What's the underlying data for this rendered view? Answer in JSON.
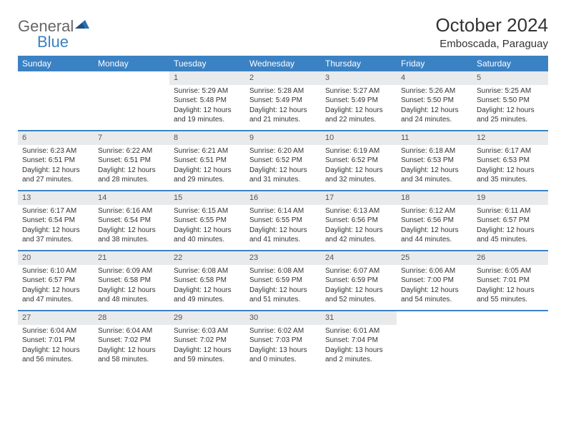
{
  "brand": {
    "part1": "General",
    "part2": "Blue"
  },
  "header": {
    "title": "October 2024",
    "location": "Emboscada, Paraguay"
  },
  "weekdays": [
    "Sunday",
    "Monday",
    "Tuesday",
    "Wednesday",
    "Thursday",
    "Friday",
    "Saturday"
  ],
  "weeks": [
    [
      {
        "empty": true
      },
      {
        "empty": true
      },
      {
        "day": "1",
        "sunrise": "5:29 AM",
        "sunset": "5:48 PM",
        "daylight": "12 hours and 19 minutes."
      },
      {
        "day": "2",
        "sunrise": "5:28 AM",
        "sunset": "5:49 PM",
        "daylight": "12 hours and 21 minutes."
      },
      {
        "day": "3",
        "sunrise": "5:27 AM",
        "sunset": "5:49 PM",
        "daylight": "12 hours and 22 minutes."
      },
      {
        "day": "4",
        "sunrise": "5:26 AM",
        "sunset": "5:50 PM",
        "daylight": "12 hours and 24 minutes."
      },
      {
        "day": "5",
        "sunrise": "5:25 AM",
        "sunset": "5:50 PM",
        "daylight": "12 hours and 25 minutes."
      }
    ],
    [
      {
        "day": "6",
        "sunrise": "6:23 AM",
        "sunset": "6:51 PM",
        "daylight": "12 hours and 27 minutes."
      },
      {
        "day": "7",
        "sunrise": "6:22 AM",
        "sunset": "6:51 PM",
        "daylight": "12 hours and 28 minutes."
      },
      {
        "day": "8",
        "sunrise": "6:21 AM",
        "sunset": "6:51 PM",
        "daylight": "12 hours and 29 minutes."
      },
      {
        "day": "9",
        "sunrise": "6:20 AM",
        "sunset": "6:52 PM",
        "daylight": "12 hours and 31 minutes."
      },
      {
        "day": "10",
        "sunrise": "6:19 AM",
        "sunset": "6:52 PM",
        "daylight": "12 hours and 32 minutes."
      },
      {
        "day": "11",
        "sunrise": "6:18 AM",
        "sunset": "6:53 PM",
        "daylight": "12 hours and 34 minutes."
      },
      {
        "day": "12",
        "sunrise": "6:17 AM",
        "sunset": "6:53 PM",
        "daylight": "12 hours and 35 minutes."
      }
    ],
    [
      {
        "day": "13",
        "sunrise": "6:17 AM",
        "sunset": "6:54 PM",
        "daylight": "12 hours and 37 minutes."
      },
      {
        "day": "14",
        "sunrise": "6:16 AM",
        "sunset": "6:54 PM",
        "daylight": "12 hours and 38 minutes."
      },
      {
        "day": "15",
        "sunrise": "6:15 AM",
        "sunset": "6:55 PM",
        "daylight": "12 hours and 40 minutes."
      },
      {
        "day": "16",
        "sunrise": "6:14 AM",
        "sunset": "6:55 PM",
        "daylight": "12 hours and 41 minutes."
      },
      {
        "day": "17",
        "sunrise": "6:13 AM",
        "sunset": "6:56 PM",
        "daylight": "12 hours and 42 minutes."
      },
      {
        "day": "18",
        "sunrise": "6:12 AM",
        "sunset": "6:56 PM",
        "daylight": "12 hours and 44 minutes."
      },
      {
        "day": "19",
        "sunrise": "6:11 AM",
        "sunset": "6:57 PM",
        "daylight": "12 hours and 45 minutes."
      }
    ],
    [
      {
        "day": "20",
        "sunrise": "6:10 AM",
        "sunset": "6:57 PM",
        "daylight": "12 hours and 47 minutes."
      },
      {
        "day": "21",
        "sunrise": "6:09 AM",
        "sunset": "6:58 PM",
        "daylight": "12 hours and 48 minutes."
      },
      {
        "day": "22",
        "sunrise": "6:08 AM",
        "sunset": "6:58 PM",
        "daylight": "12 hours and 49 minutes."
      },
      {
        "day": "23",
        "sunrise": "6:08 AM",
        "sunset": "6:59 PM",
        "daylight": "12 hours and 51 minutes."
      },
      {
        "day": "24",
        "sunrise": "6:07 AM",
        "sunset": "6:59 PM",
        "daylight": "12 hours and 52 minutes."
      },
      {
        "day": "25",
        "sunrise": "6:06 AM",
        "sunset": "7:00 PM",
        "daylight": "12 hours and 54 minutes."
      },
      {
        "day": "26",
        "sunrise": "6:05 AM",
        "sunset": "7:01 PM",
        "daylight": "12 hours and 55 minutes."
      }
    ],
    [
      {
        "day": "27",
        "sunrise": "6:04 AM",
        "sunset": "7:01 PM",
        "daylight": "12 hours and 56 minutes."
      },
      {
        "day": "28",
        "sunrise": "6:04 AM",
        "sunset": "7:02 PM",
        "daylight": "12 hours and 58 minutes."
      },
      {
        "day": "29",
        "sunrise": "6:03 AM",
        "sunset": "7:02 PM",
        "daylight": "12 hours and 59 minutes."
      },
      {
        "day": "30",
        "sunrise": "6:02 AM",
        "sunset": "7:03 PM",
        "daylight": "13 hours and 0 minutes."
      },
      {
        "day": "31",
        "sunrise": "6:01 AM",
        "sunset": "7:04 PM",
        "daylight": "13 hours and 2 minutes."
      },
      {
        "empty": true
      },
      {
        "empty": true
      }
    ]
  ],
  "labels": {
    "sunrise": "Sunrise:",
    "sunset": "Sunset:",
    "daylight": "Daylight:"
  }
}
